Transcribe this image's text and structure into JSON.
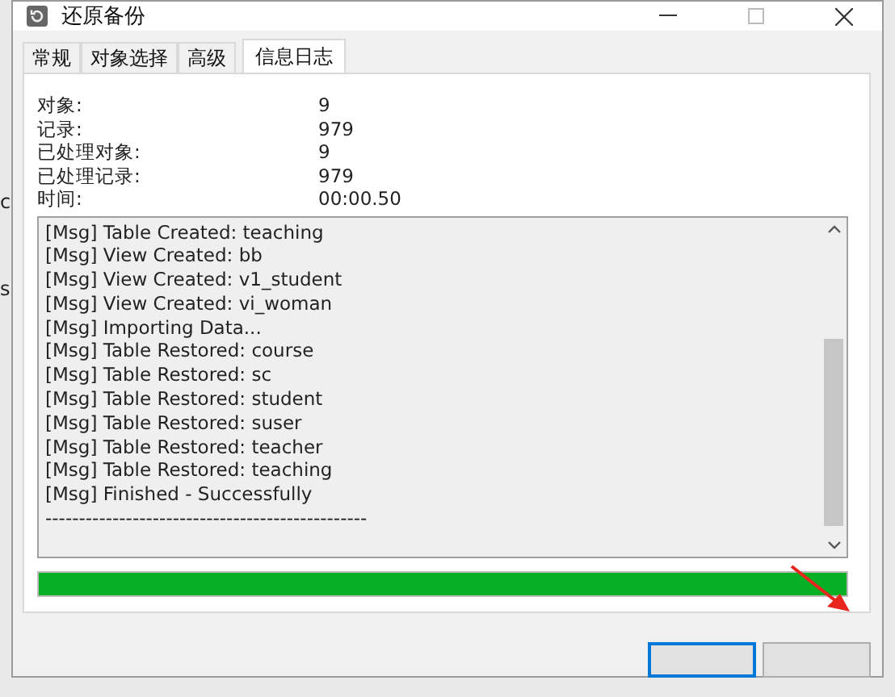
{
  "background": {
    "fragments": [
      "c",
      "s"
    ]
  },
  "window": {
    "title": "还原备份"
  },
  "tabs": [
    {
      "label": "常规",
      "selected": false
    },
    {
      "label": "对象选择",
      "selected": false
    },
    {
      "label": "高级",
      "selected": false
    },
    {
      "label": "信息日志",
      "selected": true
    }
  ],
  "info": [
    {
      "label": "对象:",
      "value": "9"
    },
    {
      "label": "记录:",
      "value": "979"
    },
    {
      "label": "已处理对象:",
      "value": "9"
    },
    {
      "label": "已处理记录:",
      "value": "979"
    },
    {
      "label": "时间:",
      "value": "00:00.50"
    }
  ],
  "log": [
    "[Msg] Table Created: teaching",
    "[Msg] View Created: bb",
    "[Msg] View Created: v1_student",
    "[Msg] View Created: vi_woman",
    "[Msg] Importing Data...",
    "[Msg] Table Restored: course",
    "[Msg] Table Restored: sc",
    "[Msg] Table Restored: student",
    "[Msg] Table Restored: suser",
    "[Msg] Table Restored: teacher",
    "[Msg] Table Restored: teaching",
    "[Msg] Finished - Successfully",
    "------------------------------------------------"
  ],
  "progress": {
    "level": 1
  },
  "buttons": [
    {
      "selected": true
    },
    {
      "selected": false
    }
  ]
}
